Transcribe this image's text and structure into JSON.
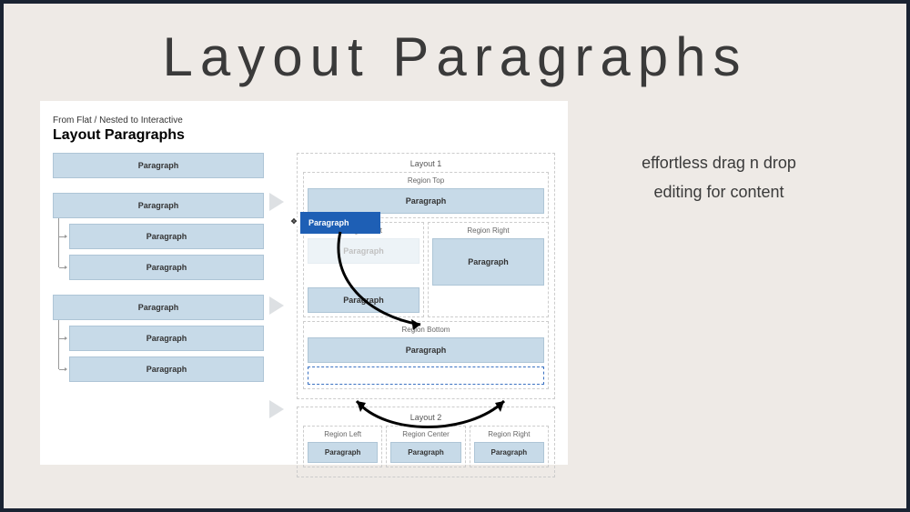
{
  "title": "Layout Paragraphs",
  "subtitle": "From Flat / Nested to Interactive",
  "heading": "Layout Paragraphs",
  "sidetext": {
    "line1": "effortless drag n drop",
    "line2": "editing for content"
  },
  "flat": {
    "p1": "Paragraph",
    "p2": "Paragraph",
    "p2a": "Paragraph",
    "p2b": "Paragraph",
    "p3": "Paragraph",
    "p3a": "Paragraph",
    "p3b": "Paragraph"
  },
  "layout1": {
    "title": "Layout 1",
    "regionTop": {
      "title": "Region Top",
      "p": "Paragraph"
    },
    "regionLeft": {
      "title": "Region Left",
      "ghost": "Paragraph",
      "p": "Paragraph"
    },
    "regionRight": {
      "title": "Region Right",
      "p": "Paragraph"
    },
    "regionBottom": {
      "title": "Region Bottom",
      "p": "Paragraph"
    }
  },
  "layout2": {
    "title": "Layout 2",
    "regionLeft": {
      "title": "Region Left",
      "p": "Paragraph"
    },
    "regionCenter": {
      "title": "Region Center",
      "p": "Paragraph"
    },
    "regionRight": {
      "title": "Region Right",
      "p": "Paragraph"
    }
  },
  "drag": {
    "label": "Paragraph",
    "grip": "✥"
  }
}
